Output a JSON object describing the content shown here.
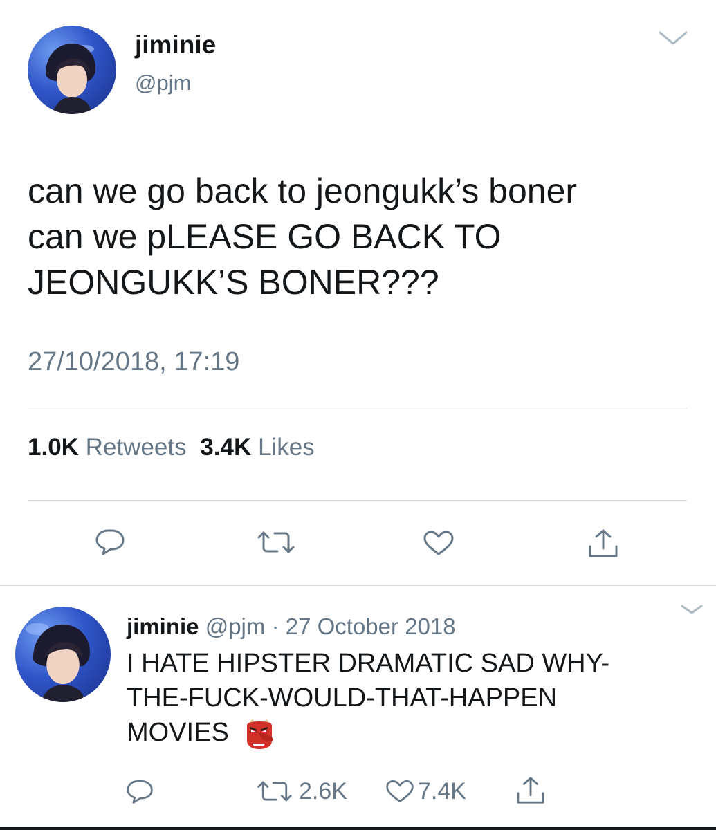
{
  "main_tweet": {
    "display_name": "jiminie",
    "handle": "@pjm",
    "text_lines": [
      "can we go back to jeongukk’s boner",
      "can we pLEASE GO BACK TO",
      "JEONGUKK’S BONER???"
    ],
    "timestamp": "27/10/2018, 17:19",
    "retweets_count": "1.0K",
    "retweets_label": "Retweets",
    "likes_count": "3.4K",
    "likes_label": "Likes",
    "icons": [
      "reply-icon",
      "retweet-icon",
      "like-icon",
      "share-icon",
      "chevron-down-icon"
    ]
  },
  "reply_tweet": {
    "display_name": "jiminie",
    "handle": "@pjm",
    "separator": "·",
    "date": "27 October 2018",
    "text_lines": [
      "I HATE HIPSTER DRAMATIC SAD WHY-",
      "THE-FUCK-WOULD-THAT-HAPPEN",
      "MOVIES"
    ],
    "emoji": "goblin-mask-emoji",
    "retweets_count": "2.6K",
    "likes_count": "7.4K",
    "icons": [
      "reply-icon",
      "retweet-icon",
      "like-icon",
      "share-icon",
      "chevron-down-icon"
    ]
  },
  "colors": {
    "text": "#14171a",
    "muted": "#657786",
    "divider": "#d5dbe0",
    "icon": "#657786",
    "emoji_red": "#d0322a"
  }
}
